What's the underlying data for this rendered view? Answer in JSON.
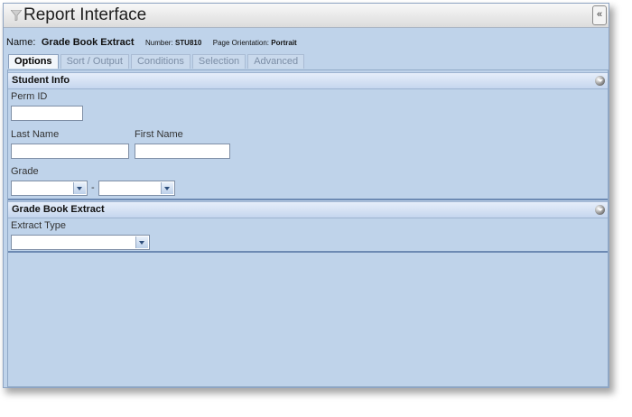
{
  "window": {
    "title": "Report Interface",
    "collapse_label": "«"
  },
  "report": {
    "name_label": "Name:",
    "name_value": "Grade Book Extract",
    "number_label": "Number:",
    "number_value": "STU810",
    "orientation_label": "Page Orientation:",
    "orientation_value": "Portrait"
  },
  "tabs": [
    "Options",
    "Sort / Output",
    "Conditions",
    "Selection",
    "Advanced"
  ],
  "student_info": {
    "title": "Student Info",
    "perm_id_label": "Perm ID",
    "perm_id_value": "",
    "last_name_label": "Last Name",
    "last_name_value": "",
    "first_name_label": "First Name",
    "first_name_value": "",
    "grade_label": "Grade",
    "grade_from": "",
    "grade_separator": "-",
    "grade_to": ""
  },
  "grade_book_extract": {
    "title": "Grade Book Extract",
    "extract_type_label": "Extract Type",
    "extract_type_value": ""
  }
}
